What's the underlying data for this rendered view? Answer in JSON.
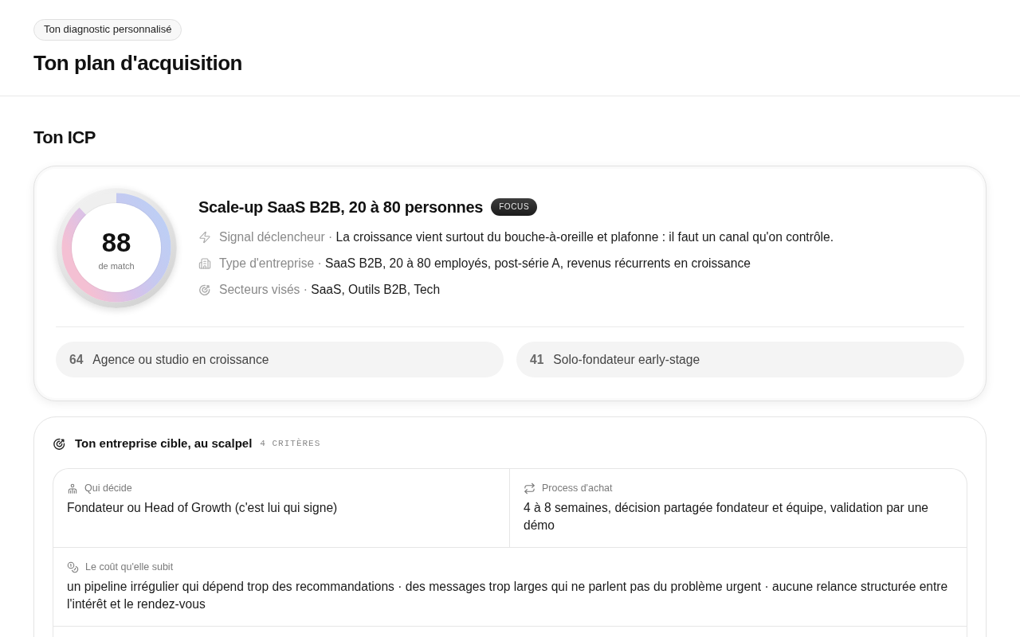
{
  "header": {
    "badge": "Ton diagnostic personnalisé",
    "title": "Ton plan d'acquisition"
  },
  "icp_section": {
    "title": "Ton ICP",
    "primary": {
      "score": "88",
      "score_label": "de match",
      "level": 0.88,
      "name": "Scale-up SaaS B2B, 20 à 80 personnes",
      "tag": "FOCUS",
      "details": [
        {
          "kind": "trigger",
          "label": "Signal déclencheur ·",
          "value": "La croissance vient surtout du bouche-à-oreille et plafonne : il faut un canal qu'on contrôle."
        },
        {
          "kind": "company",
          "label": "Type d'entreprise ·",
          "value": "SaaS B2B, 20 à 80 employés, post-série A, revenus récurrents en croissance"
        },
        {
          "kind": "sectors",
          "label": "Secteurs visés ·",
          "value": "SaaS, Outils B2B, Tech"
        }
      ]
    },
    "alternatives": [
      {
        "score": "64",
        "name": "Agence ou studio en croissance"
      },
      {
        "score": "41",
        "name": "Solo-fondateur early-stage"
      }
    ]
  },
  "target_section": {
    "title": "Ton entreprise cible, au scalpel",
    "count": "4 CRITÈRES",
    "criteria": [
      {
        "kind": "decider",
        "label": "Qui décide",
        "value": "Fondateur ou Head of Growth (c'est lui qui signe)",
        "wide": false
      },
      {
        "kind": "process",
        "label": "Process d'achat",
        "value": "4 à 8 semaines, décision partagée fondateur et équipe, validation par une démo",
        "wide": false
      },
      {
        "kind": "cost",
        "label": "Le coût qu'elle subit",
        "value": "un pipeline irrégulier qui dépend trop des recommandations · des messages trop larges qui ne parlent pas du problème urgent · aucune relance structurée entre l'intérêt et le rendez-vous",
        "wide": true
      }
    ]
  }
}
